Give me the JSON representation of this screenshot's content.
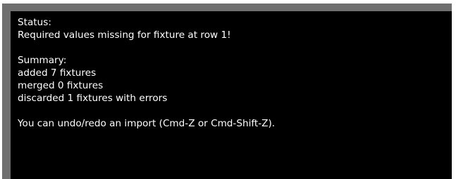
{
  "status": {
    "heading": "Status:",
    "message": "Required values missing for fixture at row 1!"
  },
  "summary": {
    "heading": "Summary:",
    "lines": [
      "added 7 fixtures",
      "merged 0 fixtures",
      "discarded 1 fixtures with errors"
    ]
  },
  "hint": "You can undo/redo an import (Cmd-Z or Cmd-Shift-Z).",
  "colors": {
    "panel_background": "#000000",
    "frame": "#6f6f6f",
    "text": "#ffffff"
  }
}
